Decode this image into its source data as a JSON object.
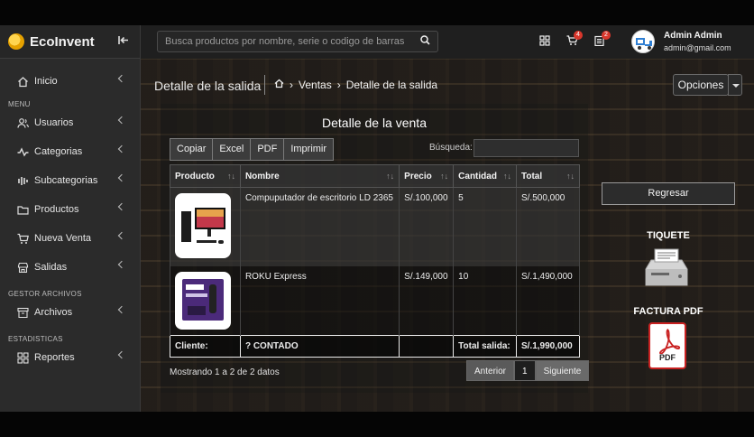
{
  "app": {
    "name": "EcoInvent"
  },
  "search": {
    "placeholder": "Busca productos por nombre, serie o codigo de barras"
  },
  "header": {
    "cart_badge": "4",
    "orders_badge": "2",
    "user_name": "Admin Admin",
    "user_email": "admin@gmail.com"
  },
  "sidebar": {
    "items": [
      {
        "label": "Inicio"
      },
      {
        "label": "Usuarios"
      },
      {
        "label": "Categorias"
      },
      {
        "label": "Subcategorias"
      },
      {
        "label": "Productos"
      },
      {
        "label": "Nueva Venta"
      },
      {
        "label": "Salidas"
      },
      {
        "label": "Archivos"
      },
      {
        "label": "Reportes"
      }
    ],
    "sections": [
      "MENU",
      "GESTOR ARCHIVOS",
      "ESTADISTICAS"
    ]
  },
  "page": {
    "title": "Detalle de la salida",
    "breadcrumb": [
      "Ventas",
      "Detalle de la salida"
    ],
    "options_label": "Opciones"
  },
  "detail": {
    "title": "Detalle de la venta",
    "export_buttons": [
      "Copiar",
      "Excel",
      "PDF",
      "Imprimir"
    ],
    "search_label": "Búsqueda:",
    "columns": [
      "Producto",
      "Nombre",
      "Precio",
      "Cantidad",
      "Total"
    ],
    "rows": [
      {
        "name": "Compuputador de escritorio LD 2365",
        "price": "S/.100,000",
        "qty": "5",
        "total": "S/.500,000"
      },
      {
        "name": "ROKU Express",
        "price": "S/.149,000",
        "qty": "10",
        "total": "S/.1,490,000"
      }
    ],
    "footer": {
      "client_label": "Cliente:",
      "client_value": "? CONTADO",
      "total_label": "Total salida:",
      "total_value": "S/.1,990,000"
    },
    "showing": "Mostrando 1 a 2 de 2 datos",
    "pager": {
      "prev": "Anterior",
      "current": "1",
      "next": "Siguiente"
    }
  },
  "actions": {
    "back": "Regresar",
    "ticket": "TIQUETE",
    "invoice": "FACTURA PDF",
    "pdf_mark": "PDF"
  }
}
